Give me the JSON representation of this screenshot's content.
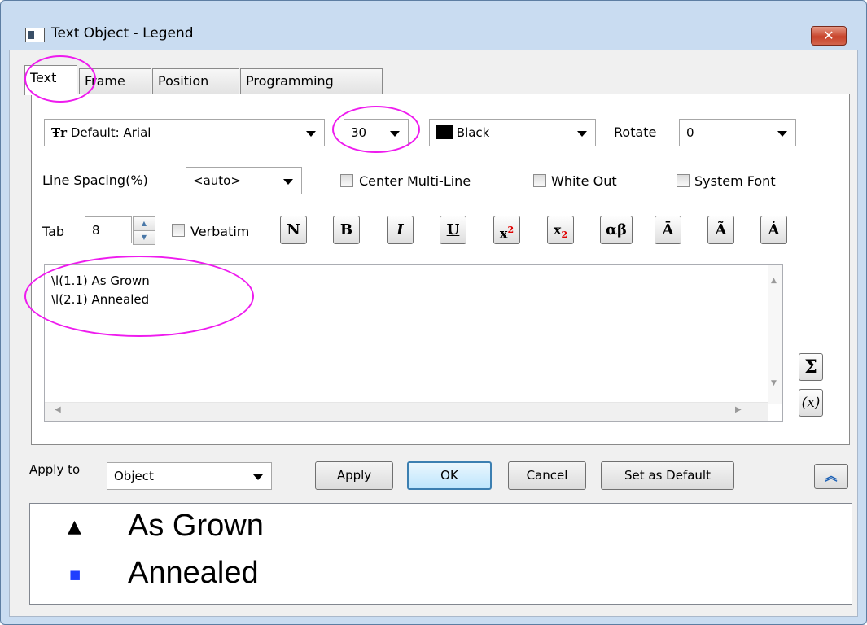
{
  "window": {
    "title": "Text Object - Legend",
    "close_glyph": "✕"
  },
  "tabs": [
    {
      "label": "Text",
      "active": true
    },
    {
      "label": "Frame",
      "active": false
    },
    {
      "label": "Position",
      "active": false
    },
    {
      "label": "Programming",
      "active": false
    }
  ],
  "font": {
    "prefix_glyph": "Ŧr",
    "value": "Default: Arial"
  },
  "size": {
    "value": "30"
  },
  "color": {
    "value": "Black",
    "swatch": "#000000"
  },
  "rotate": {
    "label": "Rotate",
    "value": "0"
  },
  "line_spacing": {
    "label": "Line Spacing(%)",
    "value": "<auto>"
  },
  "checkboxes": {
    "center_multiline": {
      "label": "Center Multi-Line",
      "checked": false
    },
    "white_out": {
      "label": "White Out",
      "checked": false
    },
    "system_font": {
      "label": "System Font",
      "checked": false
    },
    "verbatim": {
      "label": "Verbatim",
      "checked": false
    }
  },
  "tab_stop": {
    "label": "Tab",
    "value": "8"
  },
  "format_buttons": [
    {
      "name": "normal",
      "text": "N"
    },
    {
      "name": "bold",
      "text": "B"
    },
    {
      "name": "italic",
      "text": "I"
    },
    {
      "name": "underline",
      "text": "U"
    },
    {
      "name": "superscript",
      "text": "x",
      "sup": "2"
    },
    {
      "name": "subscript",
      "text": "x",
      "sub": "2"
    },
    {
      "name": "greek",
      "text": "αβ"
    },
    {
      "name": "overline",
      "text": "Ā"
    },
    {
      "name": "tilde",
      "text": "Ã"
    },
    {
      "name": "dot",
      "text": "Ȧ"
    }
  ],
  "editor": {
    "lines": [
      "\\l(1.1) As Grown",
      "\\l(2.1) Annealed"
    ]
  },
  "side_buttons": {
    "sum": "Σ",
    "var": "(x)"
  },
  "apply_to": {
    "label": "Apply to",
    "value": "Object"
  },
  "buttons": {
    "apply": "Apply",
    "ok": "OK",
    "cancel": "Cancel",
    "set_default": "Set as Default",
    "collapse_glyph": "︽"
  },
  "preview": {
    "entries": [
      {
        "symbol": "▲",
        "symbol_color": "#000000",
        "text": "As Grown"
      },
      {
        "symbol": "■",
        "symbol_color": "#1f3fff",
        "text": "Annealed"
      }
    ]
  },
  "colors": {
    "highlight": "#ee1bee",
    "accent": "#3c7fb1"
  }
}
